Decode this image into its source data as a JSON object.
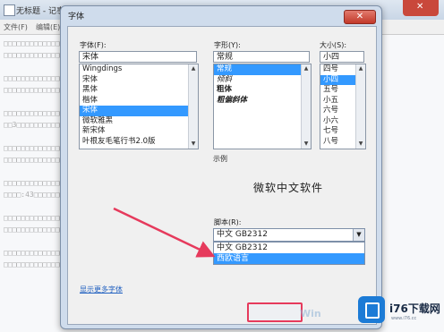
{
  "notepad": {
    "title": "无标题 - 记事本",
    "menus": [
      "文件(F)",
      "编辑(E)"
    ],
    "text_lines": [
      "□□□□□□□□□□□□□□□□□□□□□□□□□□□□□□□□□□□□□□□",
      "□□□□□□□□□□□□□□□□□□□□□□□□□□□□□□□□□□□□□□□",
      "",
      "□□□□□□□□□□□□□□□□□□□□□□□□□□□□□□□□□□□□□□□",
      "□□□□□□□□□□□□□□□□□□□□□□□□□□□□□□□□□□□□□□□",
      "",
      "□□□□□□□□□□□□□□□□□□□□□□□□□□□□□□□□□□□□□□□",
      "□□3□□□□□□□□□□□□□□□□□□□□□□□□□□□□□□□□□□□□",
      "",
      "□□□□□□□□□□□□□□□□□□□□□□□□□□□□□□□□□□□□□□□",
      "□□□□□□□□□□□□□□□□□□□□□□□□□□□□□□□□□□□□□□□",
      "",
      "□□□□□□□□□□□□□□□□□□□□□□□□□□□□□□□□□□□□□□□",
      "□□□□:43□□□□□□□□□□□□□□□□□□□□□□□□□□□□□□□□",
      "",
      "□□□□□□□□□□□□□□□□□□□□□□□□□□□□□□□□□□□□□□□",
      "□□□□□□□□□□□□□□□□□□□□□□□□□□□□□□□□□□□□□□□",
      "",
      "□□□□□□□□□□□□□□□□□□□□□□□□□□□□□□□□□□□□□□□",
      "□□□□□□□□□□□□□□□□□□□□□□□□□□□□□□□□□□□□□□□"
    ]
  },
  "dialog": {
    "title": "字体",
    "close_label": "✕",
    "font": {
      "label": "字体(F):",
      "value": "宋体",
      "items": [
        "Wingdings",
        "宋体",
        "黑体",
        "楷体",
        "宋体",
        "微软雅黑",
        "新宋体",
        "叶根友毛笔行书2.0版"
      ],
      "selected_index": 4
    },
    "style": {
      "label": "字形(Y):",
      "value": "常规",
      "items": [
        "常规",
        "倾斜",
        "粗体",
        "粗偏斜体"
      ],
      "selected_index": 0
    },
    "size": {
      "label": "大小(S):",
      "value": "小四",
      "items": [
        "四号",
        "小四",
        "五号",
        "小五",
        "六号",
        "小六",
        "七号",
        "八号"
      ],
      "selected_index": 1
    },
    "sample": {
      "label": "示例",
      "text": "微软中文软件"
    },
    "script": {
      "label": "脚本(R):",
      "value": "中文 GB2312",
      "options": [
        "中文 GB2312",
        "西欧语言"
      ],
      "highlighted_index": 1
    },
    "more_fonts_link": "显示更多字体"
  },
  "watermark": {
    "brand": "i76下载网",
    "url": "www.i76.cc",
    "badge_color": "#1c7bd6"
  },
  "colors": {
    "highlight": "#3399ff",
    "arrow": "#e63a5c"
  }
}
